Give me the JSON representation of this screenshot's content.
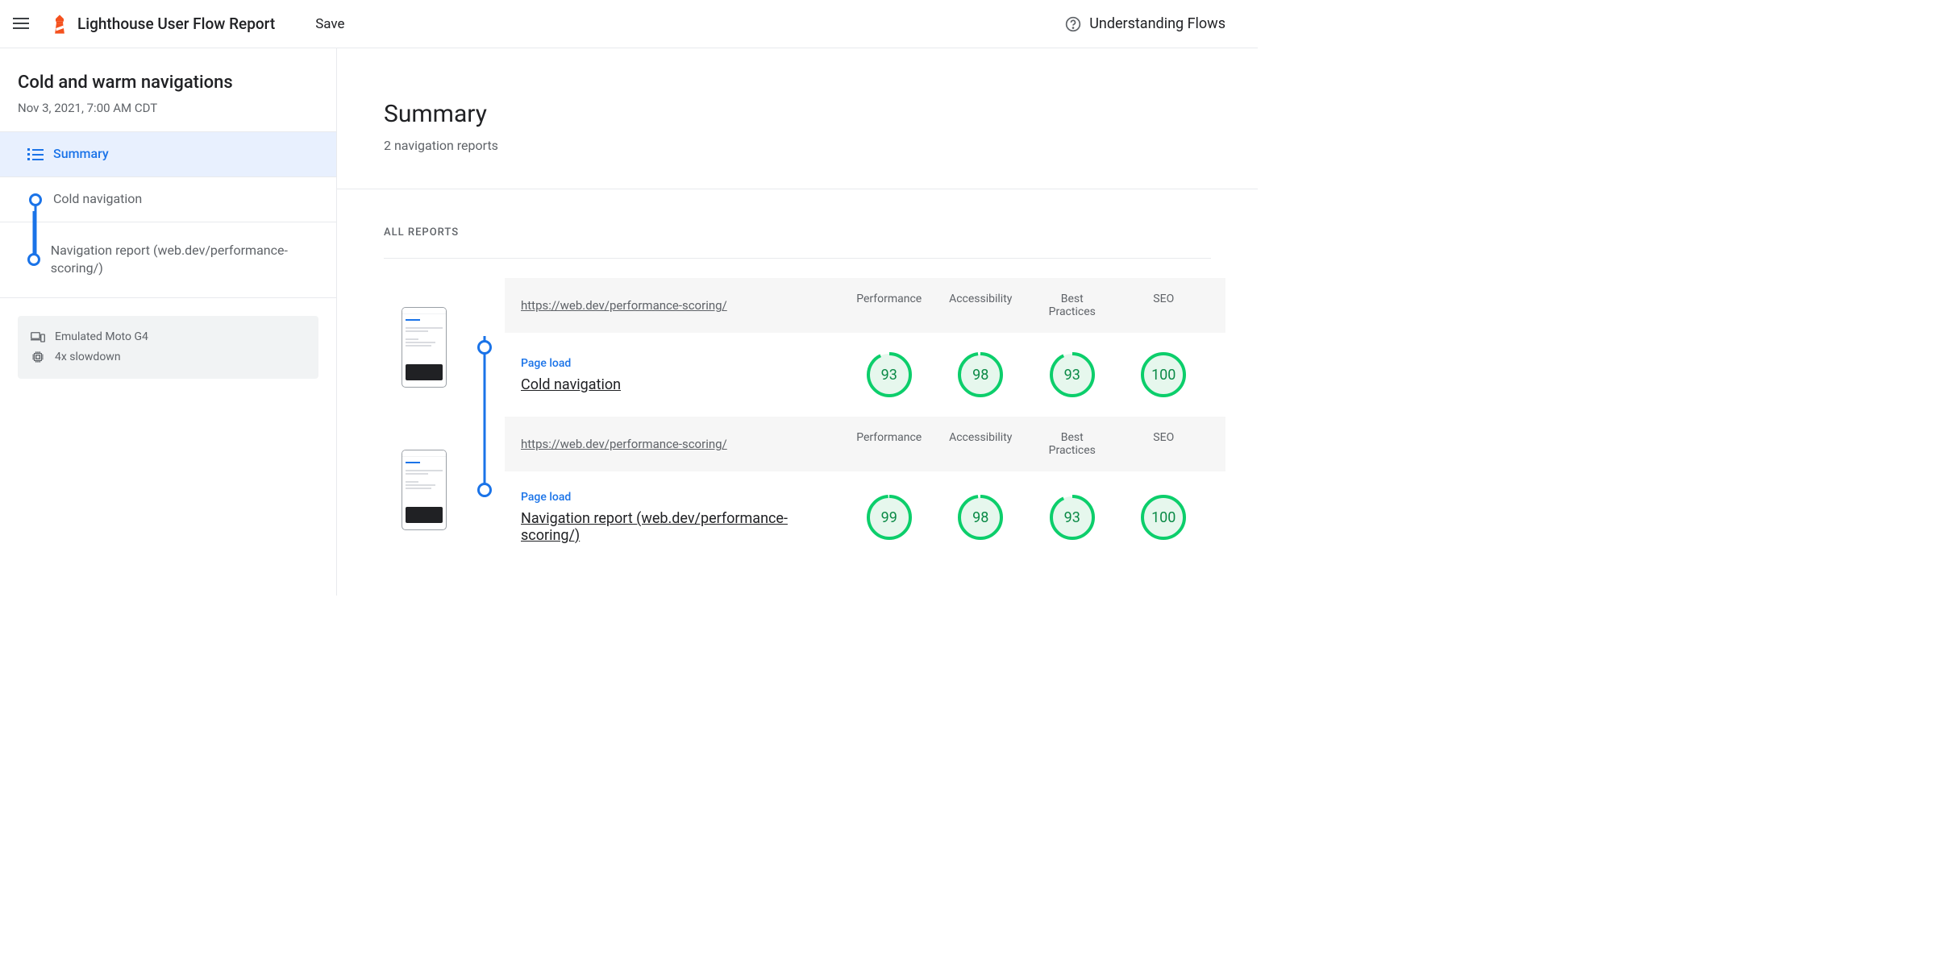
{
  "header": {
    "title": "Lighthouse User Flow Report",
    "save": "Save",
    "help": "Understanding Flows"
  },
  "sidebar": {
    "flow_title": "Cold and warm navigations",
    "flow_date": "Nov 3, 2021, 7:00 AM CDT",
    "summary_label": "Summary",
    "items": [
      {
        "label": "Cold navigation"
      },
      {
        "label": "Navigation report (web.dev/performance-scoring/)"
      }
    ],
    "settings": {
      "device": "Emulated Moto G4",
      "cpu": "4x slowdown"
    }
  },
  "main": {
    "summary_title": "Summary",
    "summary_sub": "2 navigation reports",
    "all_reports": "ALL REPORTS",
    "metric_headers": [
      "Performance",
      "Accessibility",
      "Best Practices",
      "SEO"
    ],
    "reports": [
      {
        "url": "https://web.dev/performance-scoring/",
        "step_type": "Page load",
        "step_name": "Cold navigation",
        "scores": [
          93,
          98,
          93,
          100
        ]
      },
      {
        "url": "https://web.dev/performance-scoring/",
        "step_type": "Page load",
        "step_name": "Navigation report (web.dev/performance-scoring/)",
        "scores": [
          99,
          98,
          93,
          100
        ]
      }
    ]
  },
  "colors": {
    "pass": "#0cce6b",
    "pass_fill": "#e6f7ed",
    "primary": "#1a73e8"
  }
}
